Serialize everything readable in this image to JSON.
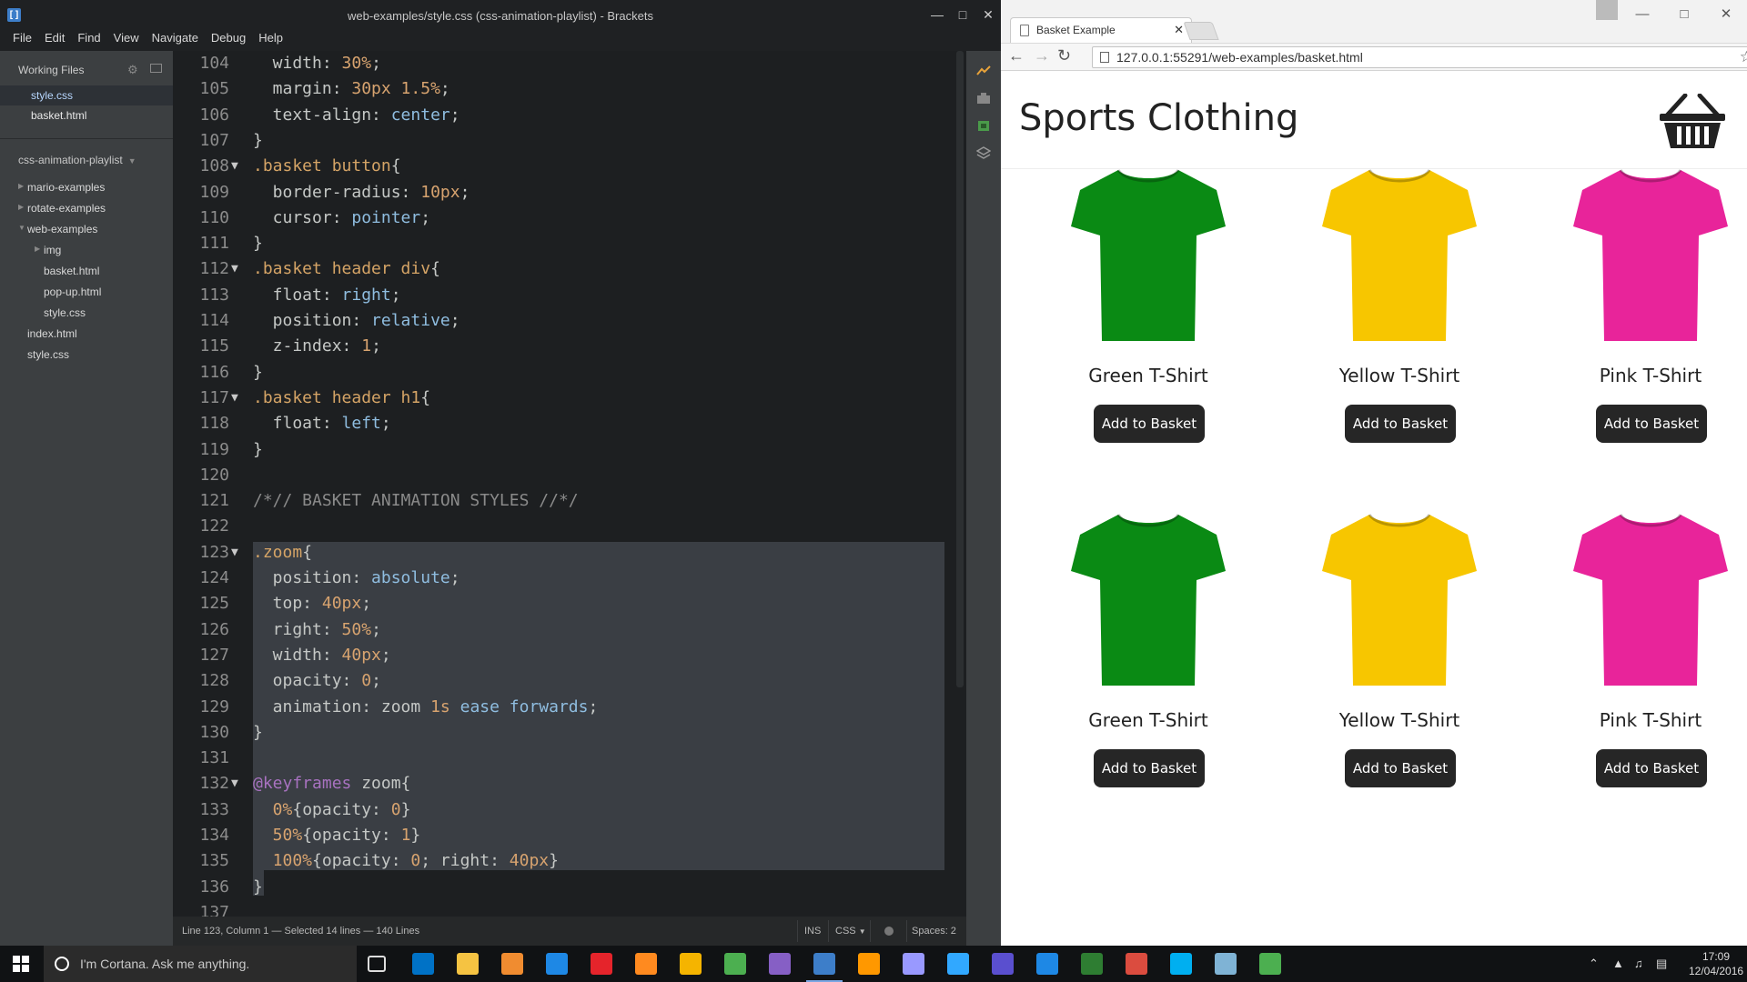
{
  "brackets": {
    "window_title": "web-examples/style.css (css-animation-playlist) - Brackets",
    "menu": [
      "File",
      "Edit",
      "Find",
      "View",
      "Navigate",
      "Debug",
      "Help"
    ],
    "working_files_title": "Working Files",
    "working_files": [
      {
        "name": "style.css",
        "active": true
      },
      {
        "name": "basket.html",
        "active": false
      }
    ],
    "project_title": "css-animation-playlist",
    "tree": [
      {
        "label": "mario-examples",
        "indent": 0,
        "folder": true,
        "open": false
      },
      {
        "label": "rotate-examples",
        "indent": 0,
        "folder": true,
        "open": false
      },
      {
        "label": "web-examples",
        "indent": 0,
        "folder": true,
        "open": true
      },
      {
        "label": "img",
        "indent": 1,
        "folder": true,
        "open": false
      },
      {
        "label": "basket.html",
        "indent": 1,
        "folder": false
      },
      {
        "label": "pop-up.html",
        "indent": 1,
        "folder": false
      },
      {
        "label": "style.css",
        "indent": 1,
        "folder": false
      },
      {
        "label": "index.html",
        "indent": 0,
        "folder": false
      },
      {
        "label": "style.css",
        "indent": 0,
        "folder": false
      }
    ],
    "status": {
      "position": "Line 123, Column 1 — Selected 14 lines — 140 Lines",
      "mode": "INS",
      "language": "CSS",
      "spaces": "Spaces: 2"
    }
  },
  "code_lines": [
    {
      "n": "104",
      "fold": false,
      "tokens": [
        [
          "  width: ",
          "t-prop"
        ],
        [
          "30%",
          "t-num"
        ],
        [
          ";",
          "t-brace"
        ]
      ]
    },
    {
      "n": "105",
      "fold": false,
      "tokens": [
        [
          "  margin: ",
          "t-prop"
        ],
        [
          "30px 1.5%",
          "t-num"
        ],
        [
          ";",
          "t-brace"
        ]
      ]
    },
    {
      "n": "106",
      "fold": false,
      "tokens": [
        [
          "  text-align: ",
          "t-prop"
        ],
        [
          "center",
          "t-kw"
        ],
        [
          ";",
          "t-brace"
        ]
      ]
    },
    {
      "n": "107",
      "fold": false,
      "tokens": [
        [
          "}",
          "t-brace"
        ]
      ]
    },
    {
      "n": "108",
      "fold": true,
      "tokens": [
        [
          ".basket button",
          "t-sel"
        ],
        [
          "{",
          "t-brace"
        ]
      ]
    },
    {
      "n": "109",
      "fold": false,
      "tokens": [
        [
          "  border-radius: ",
          "t-prop"
        ],
        [
          "10px",
          "t-num"
        ],
        [
          ";",
          "t-brace"
        ]
      ]
    },
    {
      "n": "110",
      "fold": false,
      "tokens": [
        [
          "  cursor: ",
          "t-prop"
        ],
        [
          "pointer",
          "t-kw"
        ],
        [
          ";",
          "t-brace"
        ]
      ]
    },
    {
      "n": "111",
      "fold": false,
      "tokens": [
        [
          "}",
          "t-brace"
        ]
      ]
    },
    {
      "n": "112",
      "fold": true,
      "tokens": [
        [
          ".basket header div",
          "t-sel"
        ],
        [
          "{",
          "t-brace"
        ]
      ]
    },
    {
      "n": "113",
      "fold": false,
      "tokens": [
        [
          "  float: ",
          "t-prop"
        ],
        [
          "right",
          "t-kw"
        ],
        [
          ";",
          "t-brace"
        ]
      ]
    },
    {
      "n": "114",
      "fold": false,
      "tokens": [
        [
          "  position: ",
          "t-prop"
        ],
        [
          "relative",
          "t-kw"
        ],
        [
          ";",
          "t-brace"
        ]
      ]
    },
    {
      "n": "115",
      "fold": false,
      "tokens": [
        [
          "  z-index: ",
          "t-prop"
        ],
        [
          "1",
          "t-num"
        ],
        [
          ";",
          "t-brace"
        ]
      ]
    },
    {
      "n": "116",
      "fold": false,
      "tokens": [
        [
          "}",
          "t-brace"
        ]
      ]
    },
    {
      "n": "117",
      "fold": true,
      "tokens": [
        [
          ".basket header h1",
          "t-sel"
        ],
        [
          "{",
          "t-brace"
        ]
      ]
    },
    {
      "n": "118",
      "fold": false,
      "tokens": [
        [
          "  float: ",
          "t-prop"
        ],
        [
          "left",
          "t-kw"
        ],
        [
          ";",
          "t-brace"
        ]
      ]
    },
    {
      "n": "119",
      "fold": false,
      "tokens": [
        [
          "}",
          "t-brace"
        ]
      ]
    },
    {
      "n": "120",
      "fold": false,
      "tokens": []
    },
    {
      "n": "121",
      "fold": false,
      "tokens": [
        [
          "/*// BASKET ANIMATION STYLES //*/",
          "t-com"
        ]
      ]
    },
    {
      "n": "122",
      "fold": false,
      "tokens": []
    },
    {
      "n": "123",
      "fold": true,
      "tokens": [
        [
          ".zoom",
          "t-sel"
        ],
        [
          "{",
          "t-brace"
        ]
      ]
    },
    {
      "n": "124",
      "fold": false,
      "tokens": [
        [
          "  position: ",
          "t-prop"
        ],
        [
          "absolute",
          "t-kw"
        ],
        [
          ";",
          "t-brace"
        ]
      ]
    },
    {
      "n": "125",
      "fold": false,
      "tokens": [
        [
          "  top: ",
          "t-prop"
        ],
        [
          "40px",
          "t-num"
        ],
        [
          ";",
          "t-brace"
        ]
      ]
    },
    {
      "n": "126",
      "fold": false,
      "tokens": [
        [
          "  right: ",
          "t-prop"
        ],
        [
          "50%",
          "t-num"
        ],
        [
          ";",
          "t-brace"
        ]
      ]
    },
    {
      "n": "127",
      "fold": false,
      "tokens": [
        [
          "  width: ",
          "t-prop"
        ],
        [
          "40px",
          "t-num"
        ],
        [
          ";",
          "t-brace"
        ]
      ]
    },
    {
      "n": "128",
      "fold": false,
      "tokens": [
        [
          "  opacity: ",
          "t-prop"
        ],
        [
          "0",
          "t-num"
        ],
        [
          ";",
          "t-brace"
        ]
      ]
    },
    {
      "n": "129",
      "fold": false,
      "tokens": [
        [
          "  animation: zoom ",
          "t-prop"
        ],
        [
          "1s",
          "t-num"
        ],
        [
          " ease forwards",
          "t-kw"
        ],
        [
          ";",
          "t-brace"
        ]
      ]
    },
    {
      "n": "130",
      "fold": false,
      "tokens": [
        [
          "}",
          "t-brace"
        ]
      ]
    },
    {
      "n": "131",
      "fold": false,
      "tokens": []
    },
    {
      "n": "132",
      "fold": true,
      "tokens": [
        [
          "@keyframes",
          "t-at"
        ],
        [
          " zoom{",
          "t-brace"
        ]
      ]
    },
    {
      "n": "133",
      "fold": false,
      "tokens": [
        [
          "  0%",
          "t-num"
        ],
        [
          "{opacity: ",
          "t-prop"
        ],
        [
          "0",
          "t-num"
        ],
        [
          "}",
          "t-brace"
        ]
      ]
    },
    {
      "n": "134",
      "fold": false,
      "tokens": [
        [
          "  50%",
          "t-num"
        ],
        [
          "{opacity: ",
          "t-prop"
        ],
        [
          "1",
          "t-num"
        ],
        [
          "}",
          "t-brace"
        ]
      ]
    },
    {
      "n": "135",
      "fold": false,
      "tokens": [
        [
          "  100%",
          "t-num"
        ],
        [
          "{opacity: ",
          "t-prop"
        ],
        [
          "0",
          "t-num"
        ],
        [
          "; right: ",
          "t-prop"
        ],
        [
          "40px",
          "t-num"
        ],
        [
          "}",
          "t-brace"
        ]
      ]
    },
    {
      "n": "136",
      "fold": false,
      "tokens": [
        [
          "}",
          "t-brace"
        ]
      ]
    },
    {
      "n": "137",
      "fold": false,
      "tokens": []
    }
  ],
  "chrome": {
    "tab_title": "Basket Example",
    "url": "127.0.0.1:55291/web-examples/basket.html"
  },
  "page": {
    "title": "Sports Clothing",
    "products": [
      {
        "name": "Green T-Shirt",
        "button": "Add to Basket",
        "color": "#0a8a14"
      },
      {
        "name": "Yellow T-Shirt",
        "button": "Add to Basket",
        "color": "#f7c600"
      },
      {
        "name": "Pink T-Shirt",
        "button": "Add to Basket",
        "color": "#e8249a"
      },
      {
        "name": "Green T-Shirt",
        "button": "Add to Basket",
        "color": "#0a8a14"
      },
      {
        "name": "Yellow T-Shirt",
        "button": "Add to Basket",
        "color": "#f7c600"
      },
      {
        "name": "Pink T-Shirt",
        "button": "Add to Basket",
        "color": "#e8249a"
      }
    ]
  },
  "taskbar": {
    "search_placeholder": "I'm Cortana. Ask me anything.",
    "time": "17:09",
    "date": "12/04/2016",
    "apps": [
      {
        "name": "task-view-icon",
        "color": "#dddddd"
      },
      {
        "name": "outlook-icon",
        "color": "#0072c6"
      },
      {
        "name": "file-explorer-icon",
        "color": "#f5c342"
      },
      {
        "name": "store-icon",
        "color": "#f08c30"
      },
      {
        "name": "edge-icon",
        "color": "#1e88e5"
      },
      {
        "name": "opera-icon",
        "color": "#e5242b"
      },
      {
        "name": "firefox-icon",
        "color": "#ff8a1f"
      },
      {
        "name": "chrome-canary-icon",
        "color": "#f5b400"
      },
      {
        "name": "chrome-icon",
        "color": "#4caf50"
      },
      {
        "name": "visual-studio-icon",
        "color": "#865fc5"
      },
      {
        "name": "brackets-icon",
        "color": "#3d7ec9"
      },
      {
        "name": "sublime-icon",
        "color": "#ff9800"
      },
      {
        "name": "premiere-icon",
        "color": "#9999ff"
      },
      {
        "name": "photoshop-icon",
        "color": "#31a8ff"
      },
      {
        "name": "app-circle-icon",
        "color": "#5a4fcf"
      },
      {
        "name": "media-player-icon",
        "color": "#1e88e5"
      },
      {
        "name": "shield-app-icon",
        "color": "#2e7d32"
      },
      {
        "name": "todoist-icon",
        "color": "#db4c3f"
      },
      {
        "name": "skype-icon",
        "color": "#00aff0"
      },
      {
        "name": "notepad-icon",
        "color": "#7fb3d5"
      },
      {
        "name": "chrome-icon-2",
        "color": "#4caf50"
      }
    ]
  }
}
